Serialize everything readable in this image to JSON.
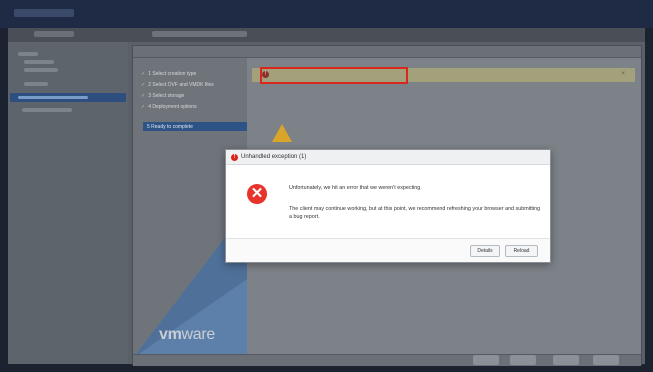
{
  "app": {
    "title": ""
  },
  "subbar": {
    "title": "",
    "breadcrumb": ""
  },
  "nav": {
    "selected": ""
  },
  "wizard": {
    "title": "",
    "steps": [
      {
        "label": "1 Select creation type"
      },
      {
        "label": "2 Select OVF and VMDK files"
      },
      {
        "label": "3 Select storage"
      },
      {
        "label": "4 Deployment options"
      },
      {
        "label": "5 Ready to complete"
      }
    ],
    "logo_vm": "vm",
    "logo_ware": "ware"
  },
  "content": {
    "alert_text": "",
    "alert_close": "×",
    "description": "",
    "warning_text": ""
  },
  "footer": {
    "back": "",
    "next": "",
    "finish": "",
    "cancel": ""
  },
  "modal": {
    "title": "Unhandled exception (1)",
    "message1": "Unfortunately, we hit an error that we weren't expecting.",
    "message2": "The client may continue working, but at this point, we recommend refreshing your browser and submitting a bug report.",
    "details_label": "Details",
    "reload_label": "Reload"
  },
  "colors": {
    "modal_error": "#e8332a",
    "highlight_border": "#d8271f",
    "wizard_accent": "#2e5386"
  }
}
